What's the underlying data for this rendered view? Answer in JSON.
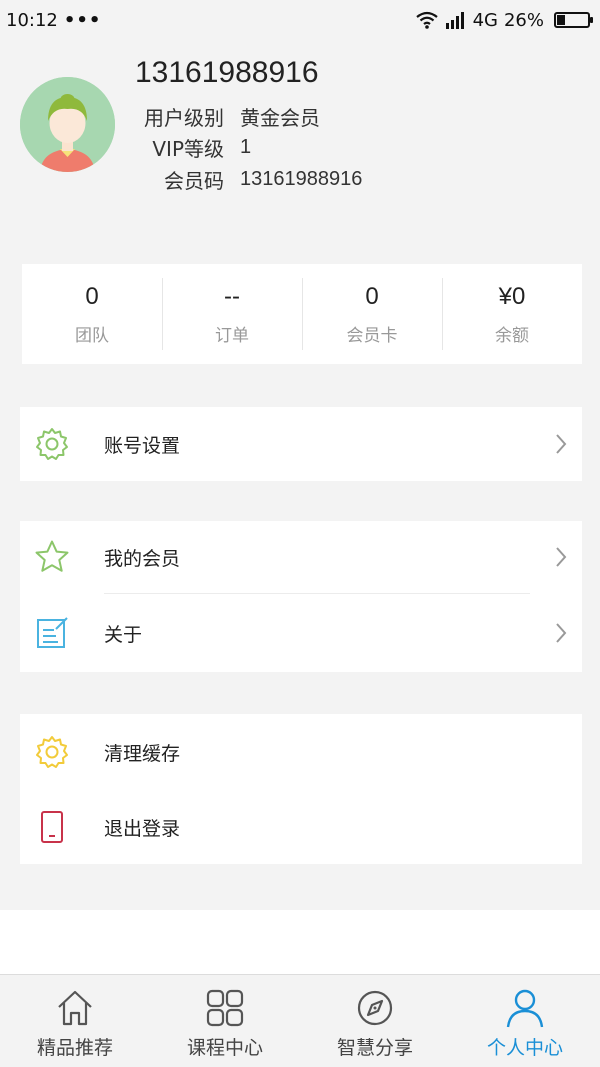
{
  "status_bar": {
    "time": "10:12",
    "dots": "•••",
    "network": "4G",
    "battery": "26%",
    "battery_level": 0.26
  },
  "profile": {
    "name": "13161988916",
    "rows": [
      {
        "label": "用户级别",
        "value": "黄金会员"
      },
      {
        "label": "VIP等级",
        "value": "1"
      },
      {
        "label": "会员码",
        "value": "13161988916"
      }
    ]
  },
  "stats": [
    {
      "value": "0",
      "label": "团队"
    },
    {
      "value": "--",
      "label": "订单"
    },
    {
      "value": "0",
      "label": "会员卡"
    },
    {
      "value": "¥0",
      "label": "余额"
    }
  ],
  "menu": {
    "account_settings": "账号设置",
    "my_members": "我的会员",
    "about": "关于",
    "clear_cache": "清理缓存",
    "logout": "退出登录"
  },
  "tabs": [
    {
      "label": "精品推荐",
      "icon": "home-icon"
    },
    {
      "label": "课程中心",
      "icon": "grid-icon"
    },
    {
      "label": "智慧分享",
      "icon": "compass-icon"
    },
    {
      "label": "个人中心",
      "icon": "person-icon"
    }
  ],
  "colors": {
    "accent": "#1a8fd6",
    "icon_green": "#8cc66a",
    "icon_yellow": "#f2cb3a",
    "icon_blue": "#4ab3e0",
    "icon_red": "#c8324a"
  }
}
